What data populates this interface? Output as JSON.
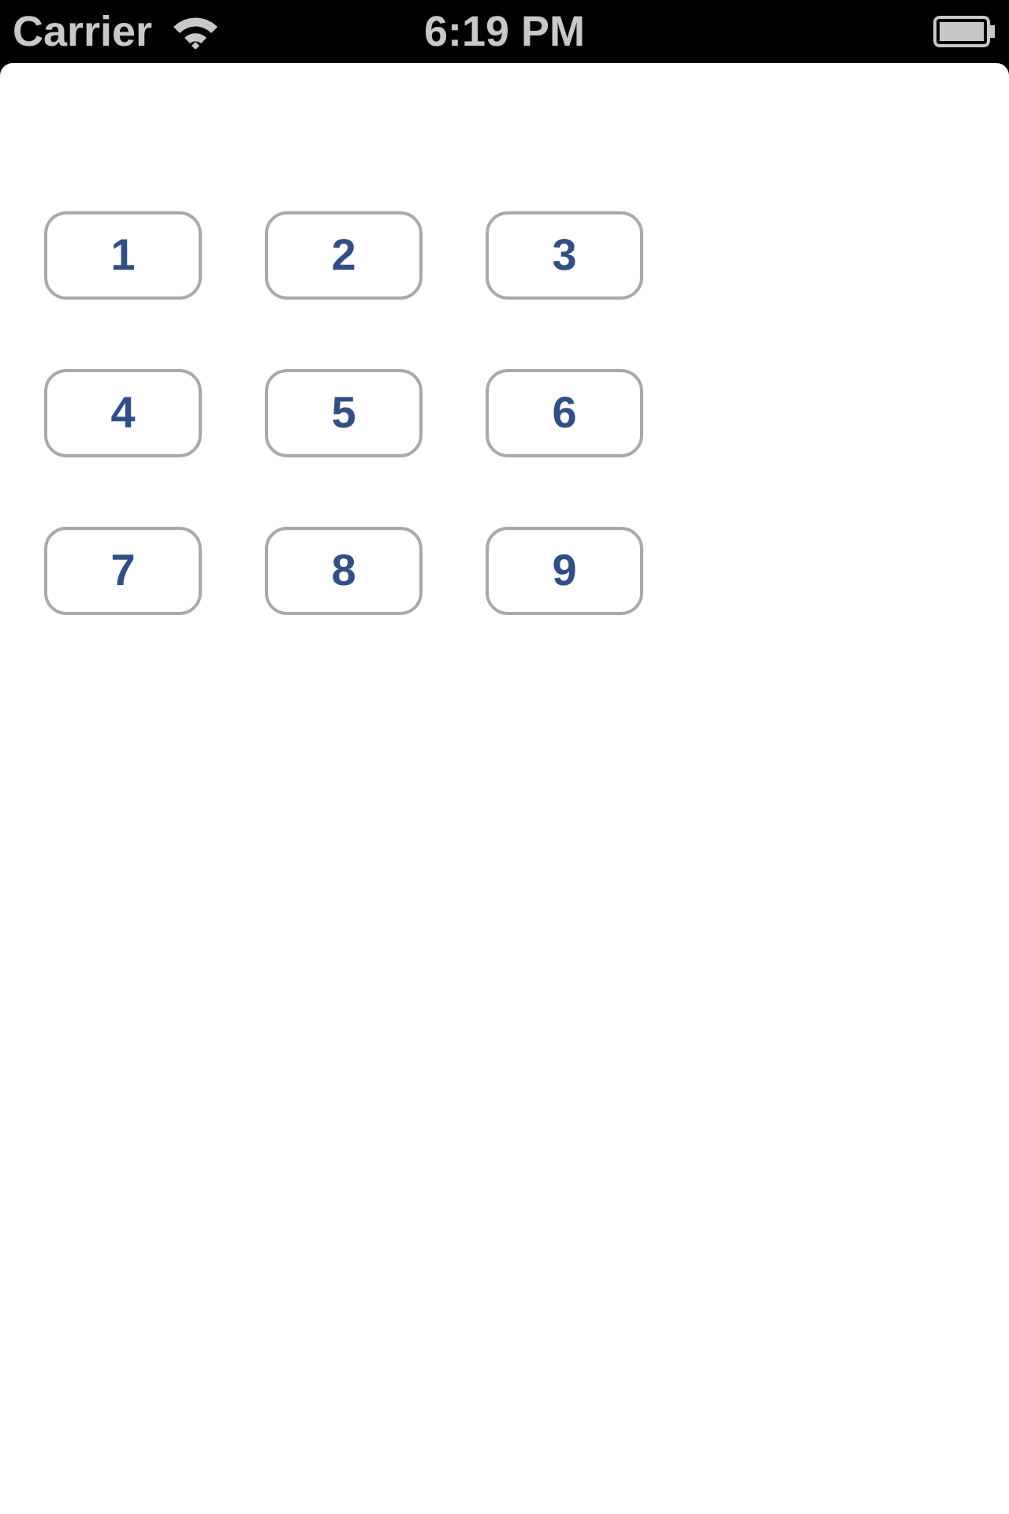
{
  "status_bar": {
    "carrier": "Carrier",
    "time": "6:19 PM"
  },
  "buttons": [
    "1",
    "2",
    "3",
    "4",
    "5",
    "6",
    "7",
    "8",
    "9"
  ]
}
